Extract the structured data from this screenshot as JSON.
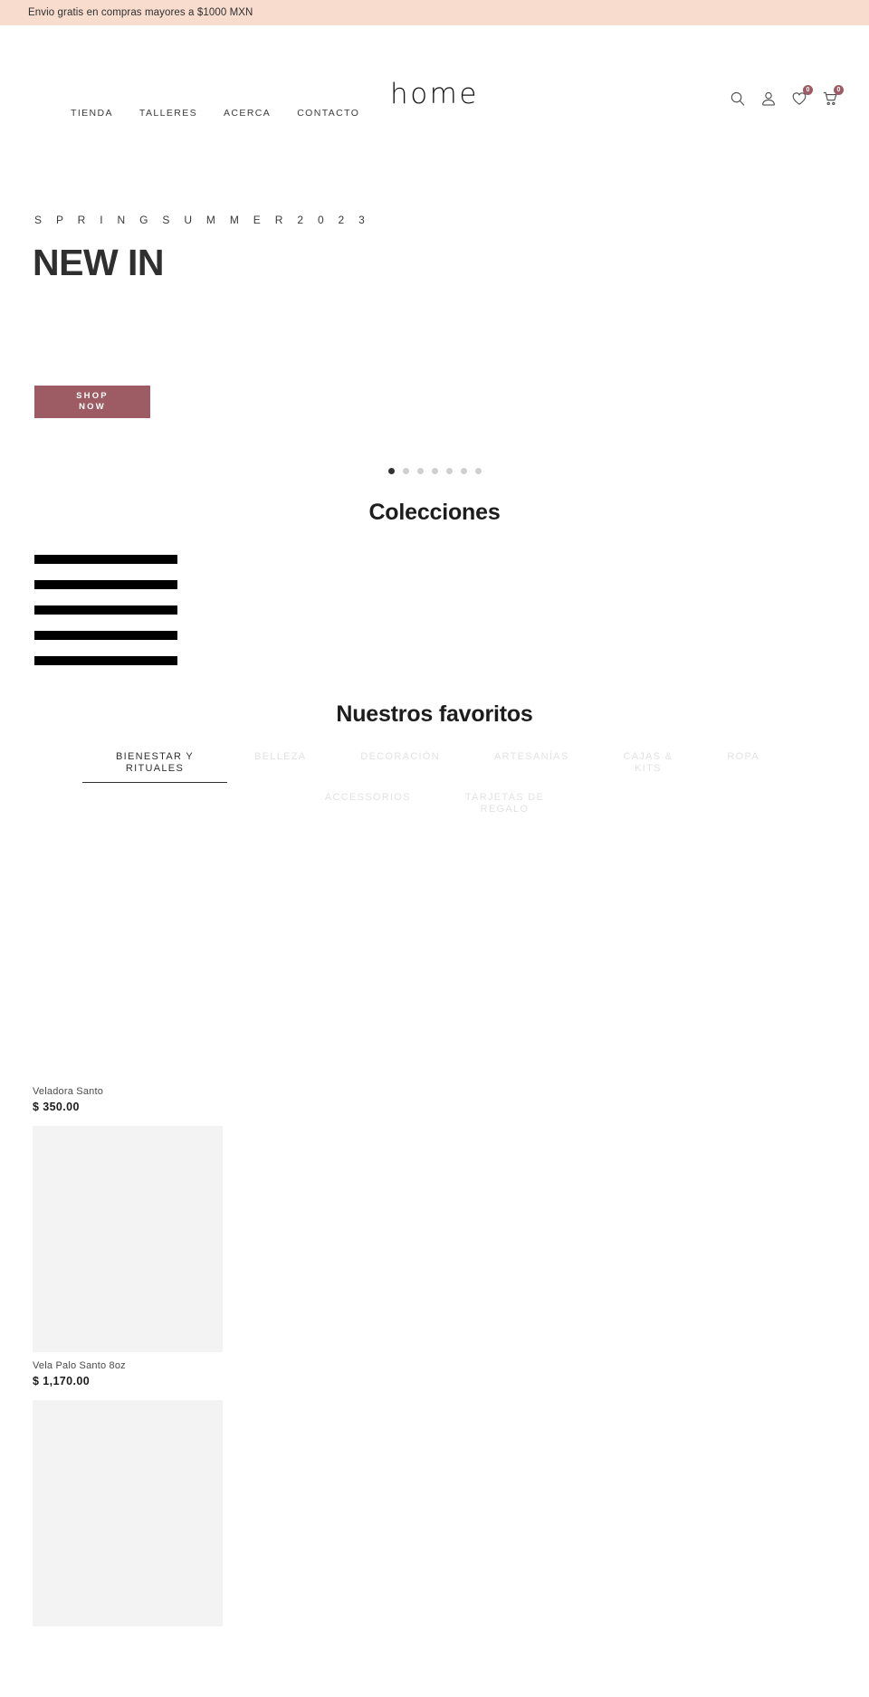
{
  "announcement": {
    "text": "Envio gratis en compras mayores a $1000 MXN",
    "background": "#f8ddcf"
  },
  "header": {
    "logo": "home",
    "nav": [
      {
        "label": "TIENDA"
      },
      {
        "label": "TALLERES"
      },
      {
        "label": "ACERCA"
      },
      {
        "label": "CONTACTO"
      }
    ],
    "icons": {
      "search": "search-icon",
      "account": "account-icon",
      "wishlist": "heart-icon",
      "cart": "cart-icon"
    },
    "wishlist_count": "0",
    "cart_count": "0",
    "badge_color": "#9d5b63"
  },
  "hero": {
    "eyebrow": "S P R I N G   S U M M E R   2 0 2 3",
    "title": "NEW IN",
    "cta_line1": "SHOP",
    "cta_line2": "NOW",
    "cta_color": "#9d5b63",
    "slide_count": 7,
    "active_slide": 1
  },
  "collections": {
    "heading": "Colecciones",
    "bar_count": 5
  },
  "favorites": {
    "heading": "Nuestros favoritos",
    "tabs": [
      {
        "label": "BIENESTAR Y\nRITUALES",
        "active": true
      },
      {
        "label": "BELLEZA",
        "active": false
      },
      {
        "label": "DECORACIÓN",
        "active": false
      },
      {
        "label": "ARTESANÍAS",
        "active": false
      },
      {
        "label": "CAJAS &\nKITS",
        "active": false
      },
      {
        "label": "ROPA",
        "active": false
      },
      {
        "label": "ACCESSORIOS",
        "active": false
      },
      {
        "label": "TARJETAS DE\nREGALO",
        "active": false
      }
    ],
    "products": [
      {
        "name": "Veladora Santo",
        "price": "$ 350.00",
        "image": "blank"
      },
      {
        "name": "Vela Palo Santo 8oz",
        "price": "$ 1,170.00",
        "image": "placeholder"
      },
      {
        "name": "",
        "price": "",
        "image": "placeholder"
      }
    ]
  }
}
